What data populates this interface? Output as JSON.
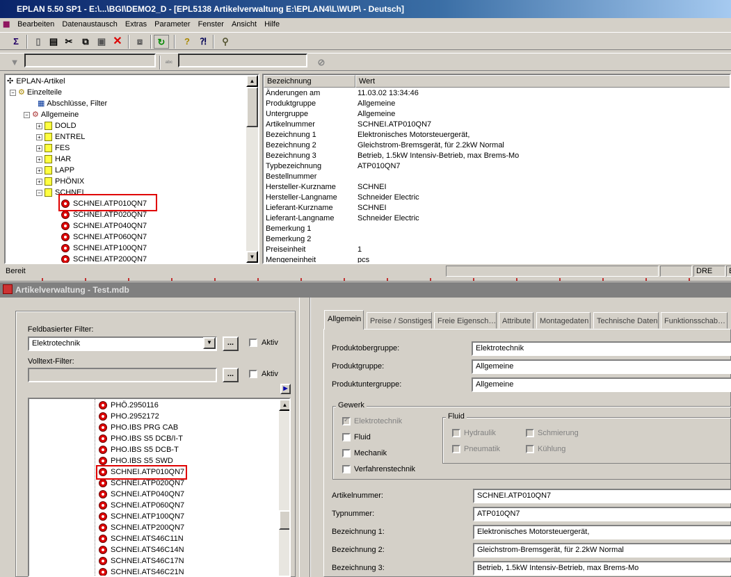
{
  "window": {
    "title": "EPLAN 5.50 SP1 - E:\\...\\BGI\\DEMO2_D - [EPL5138 Artikelverwaltung E:\\EPLAN4\\L\\WUP\\ - Deutsch]"
  },
  "menu": [
    "Bearbeiten",
    "Datenaustausch",
    "Extras",
    "Parameter",
    "Fenster",
    "Ansicht",
    "Hilfe"
  ],
  "tree": {
    "root": "EPLAN-Artikel",
    "einzelteile": "Einzelteile",
    "abschluesse": "Abschlüsse, Filter",
    "allgemeine": "Allgemeine",
    "manufacturers": [
      "DOLD",
      "ENTREL",
      "FES",
      "HAR",
      "LAPP",
      "PHÖNIX",
      "SCHNEI"
    ],
    "articles": [
      "SCHNEI.ATP010QN7",
      "SCHNEI.ATP020QN7",
      "SCHNEI.ATP040QN7",
      "SCHNEI.ATP060QN7",
      "SCHNEI.ATP100QN7",
      "SCHNEI.ATP200QN7"
    ]
  },
  "props": {
    "header_name": "Bezeichnung",
    "header_value": "Wert",
    "rows": [
      {
        "k": "Änderungen am",
        "v": "11.03.02 13:34:46"
      },
      {
        "k": "Produktgruppe",
        "v": "Allgemeine"
      },
      {
        "k": "Untergruppe",
        "v": "Allgemeine"
      },
      {
        "k": "Artikelnummer",
        "v": "SCHNEI.ATP010QN7"
      },
      {
        "k": "Bezeichnung 1",
        "v": "Elektronisches Motorsteuergerät,"
      },
      {
        "k": "Bezeichnung 2",
        "v": "Gleichstrom-Bremsgerät, für 2.2kW Normal"
      },
      {
        "k": "Bezeichnung 3",
        "v": "Betrieb, 1.5kW Intensiv-Betrieb, max Brems-Mo"
      },
      {
        "k": "Typbezeichnung",
        "v": "ATP010QN7"
      },
      {
        "k": "Bestellnummer",
        "v": ""
      },
      {
        "k": "Hersteller-Kurzname",
        "v": "SCHNEI"
      },
      {
        "k": "Hersteller-Langname",
        "v": "Schneider Electric"
      },
      {
        "k": "Lieferant-Kurzname",
        "v": "SCHNEI"
      },
      {
        "k": "Lieferant-Langname",
        "v": "Schneider Electric"
      },
      {
        "k": "Bemerkung 1",
        "v": ""
      },
      {
        "k": "Bemerkung 2",
        "v": ""
      },
      {
        "k": "Preiseinheit",
        "v": "1"
      },
      {
        "k": "Mengeneinheit",
        "v": "pcs"
      }
    ]
  },
  "status": {
    "text": "Bereit",
    "dre": "DRE",
    "e": "E"
  },
  "sub": {
    "title": "Artikelverwaltung - Test.mdb",
    "field_filter_label": "Feldbasierter Filter:",
    "field_filter_value": "Elektrotechnik",
    "dots": "...",
    "aktiv": "Aktiv",
    "fulltext_label": "Volltext-Filter:",
    "arrow": "▶",
    "list": [
      "PHÖ.2950116",
      "PHO.2952172",
      "PHO.IBS PRG CAB",
      "PHO.IBS S5 DCB/I-T",
      "PHO.IBS S5 DCB-T",
      "PHO.IBS S5 SWD",
      "SCHNEI.ATP010QN7",
      "SCHNEI.ATP020QN7",
      "SCHNEI.ATP040QN7",
      "SCHNEI.ATP060QN7",
      "SCHNEI.ATP100QN7",
      "SCHNEI.ATP200QN7",
      "SCHNEI.ATS46C11N",
      "SCHNEI.ATS46C14N",
      "SCHNEI.ATS46C17N",
      "SCHNEI.ATS46C21N"
    ],
    "tabs": [
      "Allgemein",
      "Preise / Sonstiges",
      "Freie Eigensch…",
      "Attribute",
      "Montagedaten",
      "Technische Daten",
      "Funktionsschab…"
    ],
    "form": {
      "produktobergruppe_label": "Produktobergruppe:",
      "produktobergruppe": "Elektrotechnik",
      "produktgruppe_label": "Produktgruppe:",
      "produktgruppe": "Allgemeine",
      "produktuntergruppe_label": "Produktuntergruppe:",
      "produktuntergruppe": "Allgemeine",
      "gewerk": "Gewerk",
      "elektrotechnik": "Elektrotechnik",
      "fluid_chk": "Fluid",
      "mechanik": "Mechanik",
      "verfahrenstechnik": "Verfahrenstechnik",
      "fluid": "Fluid",
      "hydraulik": "Hydraulik",
      "schmierung": "Schmierung",
      "pneumatik": "Pneumatik",
      "kuehlung": "Kühlung",
      "artikelnummer_label": "Artikelnummer:",
      "artikelnummer": "SCHNEI.ATP010QN7",
      "typnummer_label": "Typnummer:",
      "typnummer": "ATP010QN7",
      "bez1_label": "Bezeichnung 1:",
      "bez1": "Elektronisches Motorsteuergerät,",
      "bez2_label": "Bezeichnung 2:",
      "bez2": "Gleichstrom-Bremsgerät, für 2.2kW Normal",
      "bez3_label": "Bezeichnung 3:",
      "bez3": "Betrieb, 1.5kW Intensiv-Betrieb, max Brems-Mo"
    }
  }
}
